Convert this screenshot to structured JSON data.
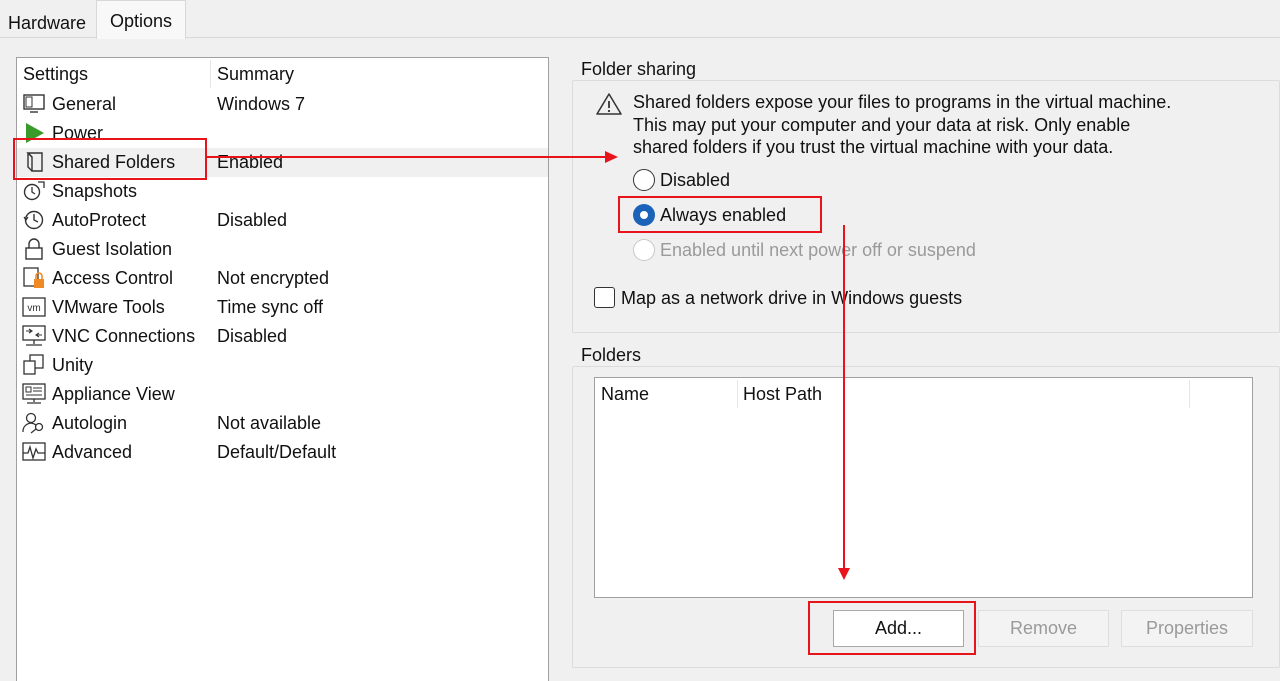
{
  "tabs": [
    {
      "label": "Hardware"
    },
    {
      "label": "Options"
    }
  ],
  "settings": {
    "col_settings": "Settings",
    "col_summary": "Summary",
    "items": [
      {
        "name": "General",
        "summary": "Windows 7",
        "icon": "monitor-icon"
      },
      {
        "name": "Power",
        "summary": "",
        "icon": "power-play-icon"
      },
      {
        "name": "Shared Folders",
        "summary": "Enabled",
        "icon": "shared-folder-icon"
      },
      {
        "name": "Snapshots",
        "summary": "",
        "icon": "snapshots-icon"
      },
      {
        "name": "AutoProtect",
        "summary": "Disabled",
        "icon": "autoprotect-clock-icon"
      },
      {
        "name": "Guest Isolation",
        "summary": "",
        "icon": "lock-icon"
      },
      {
        "name": "Access Control",
        "summary": "Not encrypted",
        "icon": "access-control-lock-icon"
      },
      {
        "name": "VMware Tools",
        "summary": "Time sync off",
        "icon": "vm-icon"
      },
      {
        "name": "VNC Connections",
        "summary": "Disabled",
        "icon": "vnc-network-icon"
      },
      {
        "name": "Unity",
        "summary": "",
        "icon": "unity-windows-icon"
      },
      {
        "name": "Appliance View",
        "summary": "",
        "icon": "appliance-view-icon"
      },
      {
        "name": "Autologin",
        "summary": "Not available",
        "icon": "autologin-user-key-icon"
      },
      {
        "name": "Advanced",
        "summary": "Default/Default",
        "icon": "advanced-waveform-icon"
      }
    ]
  },
  "folder_sharing": {
    "title": "Folder sharing",
    "warning_lines": [
      "Shared folders expose your files to programs in the virtual machine.",
      "This may put your computer and your data at risk. Only enable",
      "shared folders if you trust the virtual machine with your data."
    ],
    "options": [
      {
        "label": "Disabled",
        "state": "off"
      },
      {
        "label": "Always enabled",
        "state": "selected"
      },
      {
        "label": "Enabled until next power off or suspend",
        "state": "disabled"
      }
    ],
    "map_drive_label": "Map as a network drive in Windows guests",
    "map_drive_checked": false
  },
  "folders": {
    "title": "Folders",
    "columns": [
      "Name",
      "Host Path"
    ],
    "rows": []
  },
  "buttons": {
    "add": "Add...",
    "remove": "Remove",
    "properties": "Properties"
  },
  "colors": {
    "annotation_red": "#e8141b",
    "radio_selected": "#1a63b8",
    "power_green": "#3a9a2a",
    "lock_orange": "#f08a24"
  }
}
